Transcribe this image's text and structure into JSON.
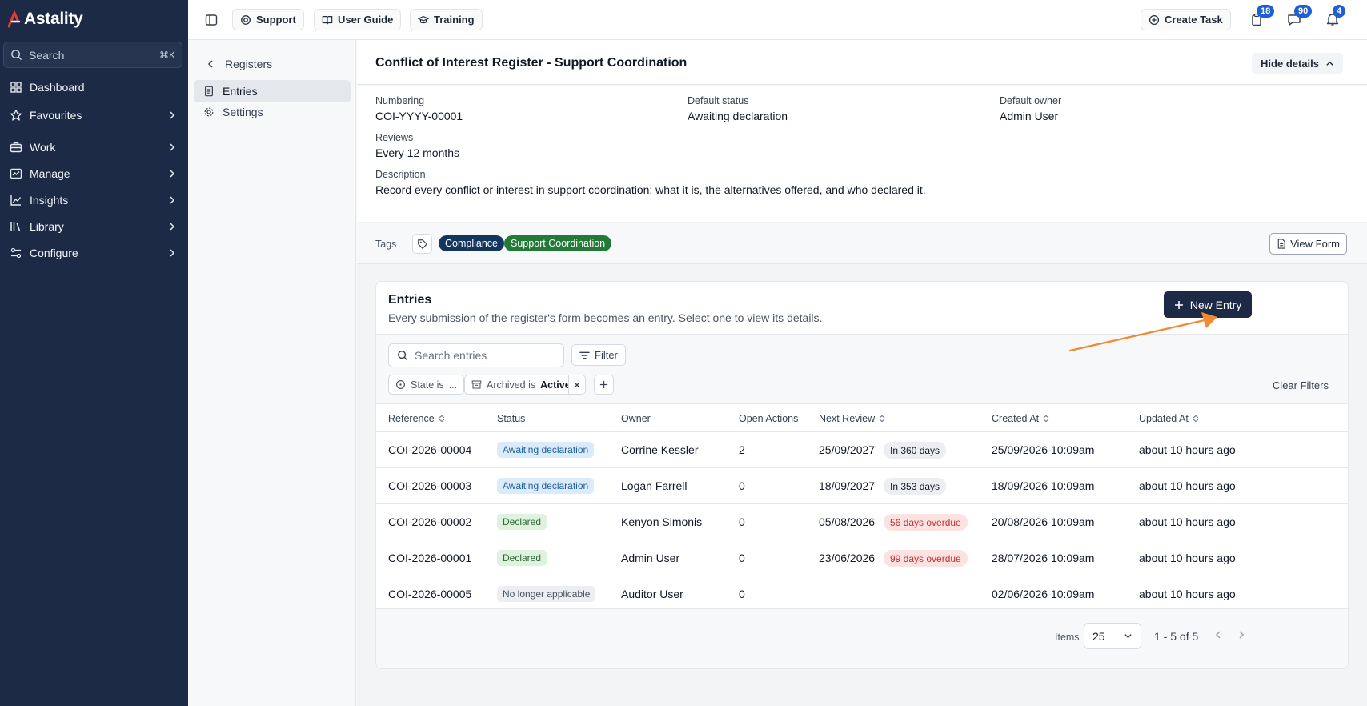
{
  "brand": {
    "name": "Astality"
  },
  "sidebar": {
    "search": {
      "placeholder": "Search",
      "shortcut": "⌘K"
    },
    "items": [
      {
        "label": "Dashboard",
        "icon": "dashboard-icon"
      },
      {
        "label": "Favourites",
        "icon": "star-icon"
      },
      {
        "label": "Work",
        "icon": "briefcase-icon"
      },
      {
        "label": "Manage",
        "icon": "manage-icon"
      },
      {
        "label": "Insights",
        "icon": "chart-icon"
      },
      {
        "label": "Library",
        "icon": "library-icon"
      },
      {
        "label": "Configure",
        "icon": "configure-icon"
      }
    ]
  },
  "topbar": {
    "support": "Support",
    "user_guide": "User Guide",
    "training": "Training",
    "create_task": "Create Task",
    "badges": {
      "tasks": "18",
      "messages": "90",
      "notifications": "4"
    }
  },
  "subnav": {
    "back": "Registers",
    "items": [
      {
        "label": "Entries"
      },
      {
        "label": "Settings"
      }
    ]
  },
  "header": {
    "title": "Conflict of Interest Register - Support Coordination",
    "hide_details": "Hide details"
  },
  "details": {
    "numbering_label": "Numbering",
    "numbering_value": "COI-YYYY-00001",
    "default_status_label": "Default status",
    "default_status_value": "Awaiting declaration",
    "default_owner_label": "Default owner",
    "default_owner_value": "Admin User",
    "reviews_label": "Reviews",
    "reviews_value": "Every 12 months",
    "description_label": "Description",
    "description_value": "Record every conflict or interest in support coordination: what it is, the alternatives offered, and who declared it."
  },
  "tags": {
    "label": "Tags",
    "items": [
      {
        "label": "Compliance",
        "color": "#14355e"
      },
      {
        "label": "Support Coordination",
        "color": "#227a36"
      }
    ],
    "view_form": "View Form"
  },
  "entries": {
    "title": "Entries",
    "subtitle": "Every submission of the register's form becomes an entry. Select one to view its details.",
    "new_entry": "New Entry",
    "search_placeholder": "Search entries",
    "filter": "Filter",
    "chips": {
      "state": "State is",
      "state_value": "...",
      "archived": "Archived is",
      "archived_value": "Active"
    },
    "clear_filters": "Clear Filters",
    "columns": [
      "Reference",
      "Status",
      "Owner",
      "Open Actions",
      "Next Review",
      "Created At",
      "Updated At"
    ],
    "rows": [
      {
        "reference": "COI-2026-00004",
        "status": "Awaiting declaration",
        "status_type": "await",
        "owner": "Corrine Kessler",
        "open_actions": "2",
        "next_review": "25/09/2027",
        "review_pill": "In 360 days",
        "pill_type": "days",
        "created_at": "25/09/2026 10:09am",
        "updated_at": "about 10 hours ago"
      },
      {
        "reference": "COI-2026-00003",
        "status": "Awaiting declaration",
        "status_type": "await",
        "owner": "Logan Farrell",
        "open_actions": "0",
        "next_review": "18/09/2027",
        "review_pill": "In 353 days",
        "pill_type": "days",
        "created_at": "18/09/2026 10:09am",
        "updated_at": "about 10 hours ago"
      },
      {
        "reference": "COI-2026-00002",
        "status": "Declared",
        "status_type": "declared",
        "owner": "Kenyon Simonis",
        "open_actions": "0",
        "next_review": "05/08/2026",
        "review_pill": "56 days overdue",
        "pill_type": "over",
        "created_at": "20/08/2026 10:09am",
        "updated_at": "about 10 hours ago"
      },
      {
        "reference": "COI-2026-00001",
        "status": "Declared",
        "status_type": "declared",
        "owner": "Admin User",
        "open_actions": "0",
        "next_review": "23/06/2026",
        "review_pill": "99 days overdue",
        "pill_type": "over",
        "created_at": "28/07/2026 10:09am",
        "updated_at": "about 10 hours ago"
      },
      {
        "reference": "COI-2026-00005",
        "status": "No longer applicable",
        "status_type": "na",
        "owner": "Auditor User",
        "open_actions": "0",
        "next_review": "",
        "review_pill": "",
        "pill_type": "",
        "created_at": "02/06/2026 10:09am",
        "updated_at": "about 10 hours ago"
      }
    ],
    "pagination": {
      "items_label": "Items",
      "page_size": "25",
      "range": "1 - 5 of 5"
    }
  },
  "annotation": {
    "arrow_color": "#f28b30"
  }
}
